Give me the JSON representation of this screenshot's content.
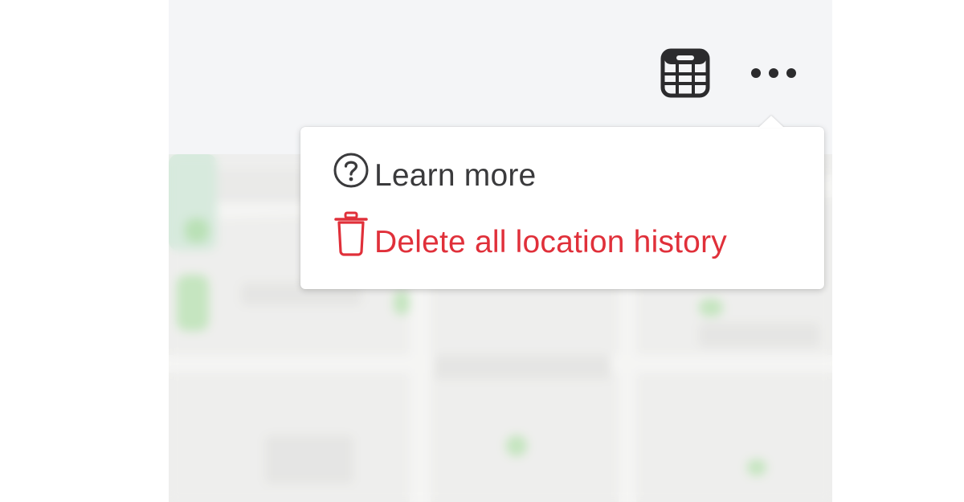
{
  "toolbar": {
    "calendar_icon": "calendar-icon",
    "more_icon": "more-horizontal-icon"
  },
  "menu": {
    "items": [
      {
        "label": "Learn more",
        "icon": "question-circle-icon",
        "color": "#3a3a3c"
      },
      {
        "label": "Delete all location history",
        "icon": "trash-icon",
        "color": "#e0303a"
      }
    ]
  },
  "colors": {
    "toolbar_bg": "#f4f5f7",
    "popover_bg": "#ffffff",
    "danger": "#e0303a",
    "text": "#3a3a3c"
  }
}
